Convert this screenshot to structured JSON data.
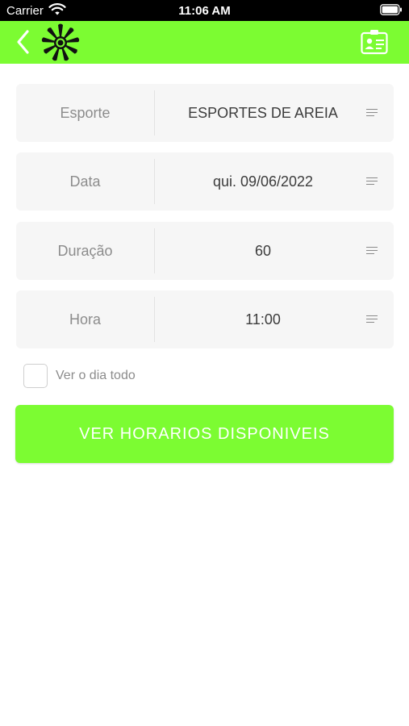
{
  "status": {
    "carrier": "Carrier",
    "time": "11:06 AM"
  },
  "nav": {
    "back_icon": "chevron-left-icon",
    "logo": "sun-logo",
    "contact_icon": "contact-card-icon",
    "bar_color": "#7cfc32"
  },
  "form": {
    "rows": [
      {
        "label": "Esporte",
        "value": "ESPORTES DE AREIA"
      },
      {
        "label": "Data",
        "value": "qui. 09/06/2022"
      },
      {
        "label": "Duração",
        "value": "60"
      },
      {
        "label": "Hora",
        "value": "11:00"
      }
    ],
    "checkbox_label": "Ver o dia todo",
    "checkbox_checked": false
  },
  "cta": {
    "label": "VER HORARIOS DISPONIVEIS",
    "color": "#7cfc32"
  }
}
